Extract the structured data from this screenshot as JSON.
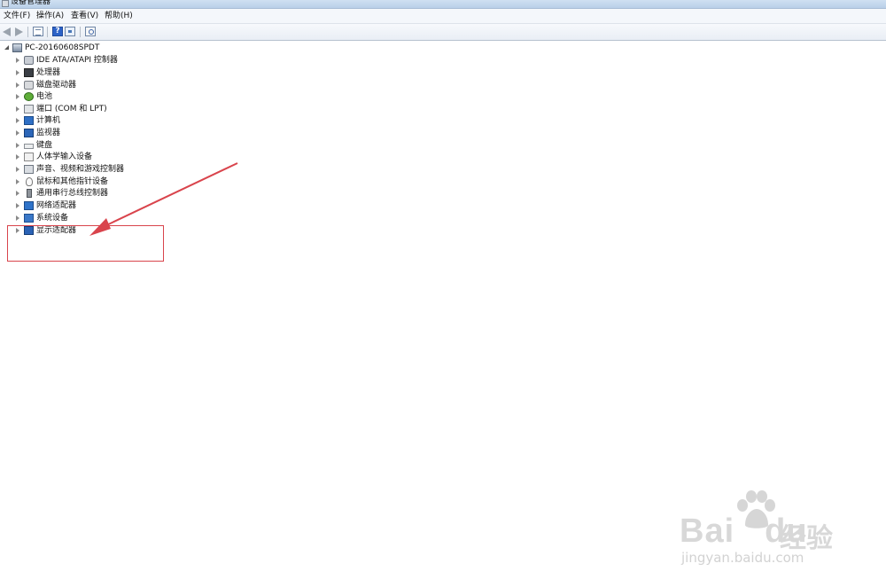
{
  "window": {
    "title": "设备管理器"
  },
  "menu": {
    "items": [
      "文件(F)",
      "操作(A)",
      "查看(V)",
      "帮助(H)"
    ]
  },
  "toolbar": {
    "buttons": [
      "back-icon",
      "forward-icon",
      "properties-icon",
      "help-icon",
      "update-driver-icon",
      "scan-hardware-icon"
    ]
  },
  "tree": {
    "root": "PC-20160608SPDT",
    "items": [
      {
        "label": "IDE ATA/ATAPI 控制器",
        "icon": "ide-controller-icon"
      },
      {
        "label": "处理器",
        "icon": "processor-icon"
      },
      {
        "label": "磁盘驱动器",
        "icon": "disk-drive-icon"
      },
      {
        "label": "电池",
        "icon": "battery-icon"
      },
      {
        "label": "端口 (COM 和 LPT)",
        "icon": "port-icon"
      },
      {
        "label": "计算机",
        "icon": "computer-icon"
      },
      {
        "label": "监视器",
        "icon": "monitor-icon"
      },
      {
        "label": "键盘",
        "icon": "keyboard-icon"
      },
      {
        "label": "人体学输入设备",
        "icon": "hid-icon"
      },
      {
        "label": "声音、视频和游戏控制器",
        "icon": "sound-icon"
      },
      {
        "label": "鼠标和其他指针设备",
        "icon": "mouse-icon"
      },
      {
        "label": "通用串行总线控制器",
        "icon": "usb-icon"
      },
      {
        "label": "网络适配器",
        "icon": "network-adapter-icon"
      },
      {
        "label": "系统设备",
        "icon": "system-device-icon"
      },
      {
        "label": "显示适配器",
        "icon": "display-adapter-icon"
      }
    ]
  },
  "annotation": {
    "color": "#d9444c"
  },
  "watermark": {
    "brand": "Bai",
    "brand2": "du",
    "cn": "经验",
    "url": "jingyan.baidu.com"
  }
}
